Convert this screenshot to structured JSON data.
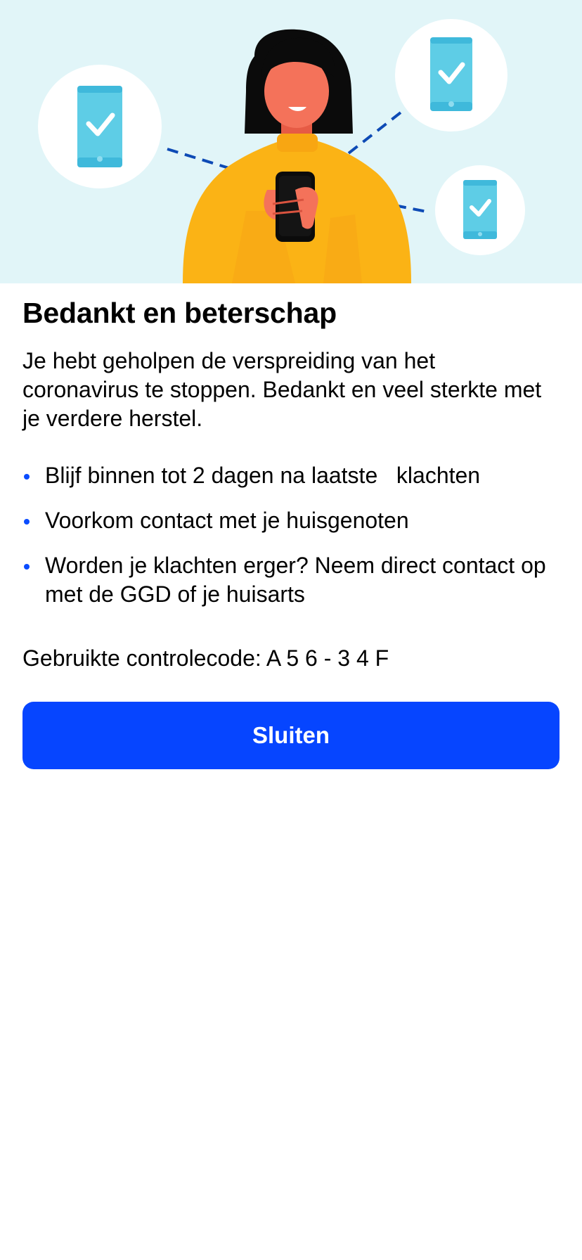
{
  "screen": {
    "title": "Bedankt en beterschap",
    "intro": "Je hebt geholpen de verspreiding van het coronavirus te stoppen. Bedankt en veel sterkte met je verdere herstel.",
    "bullets": [
      "Blijf binnen tot 2 dagen na laatste   klachten",
      "Voorkom contact met je huisgenoten",
      "Worden je klachten erger? Neem direct contact op met de GGD of je huisarts"
    ],
    "code_label": "Gebruikte controlecode: ",
    "code_value": "A 5 6 - 3 4 F",
    "close_label": "Sluiten"
  },
  "illustration": {
    "subject": "woman-with-phone",
    "icons": [
      "phone-check-icon",
      "phone-check-icon",
      "phone-check-icon"
    ]
  },
  "colors": {
    "hero_bg": "#e1f5f8",
    "accent": "#0645ff",
    "bullet": "#0a4cff",
    "sweater": "#fbb315",
    "skin": "#f4725a",
    "phone_blue": "#5ecde6",
    "dash_line": "#0d4ab5"
  }
}
